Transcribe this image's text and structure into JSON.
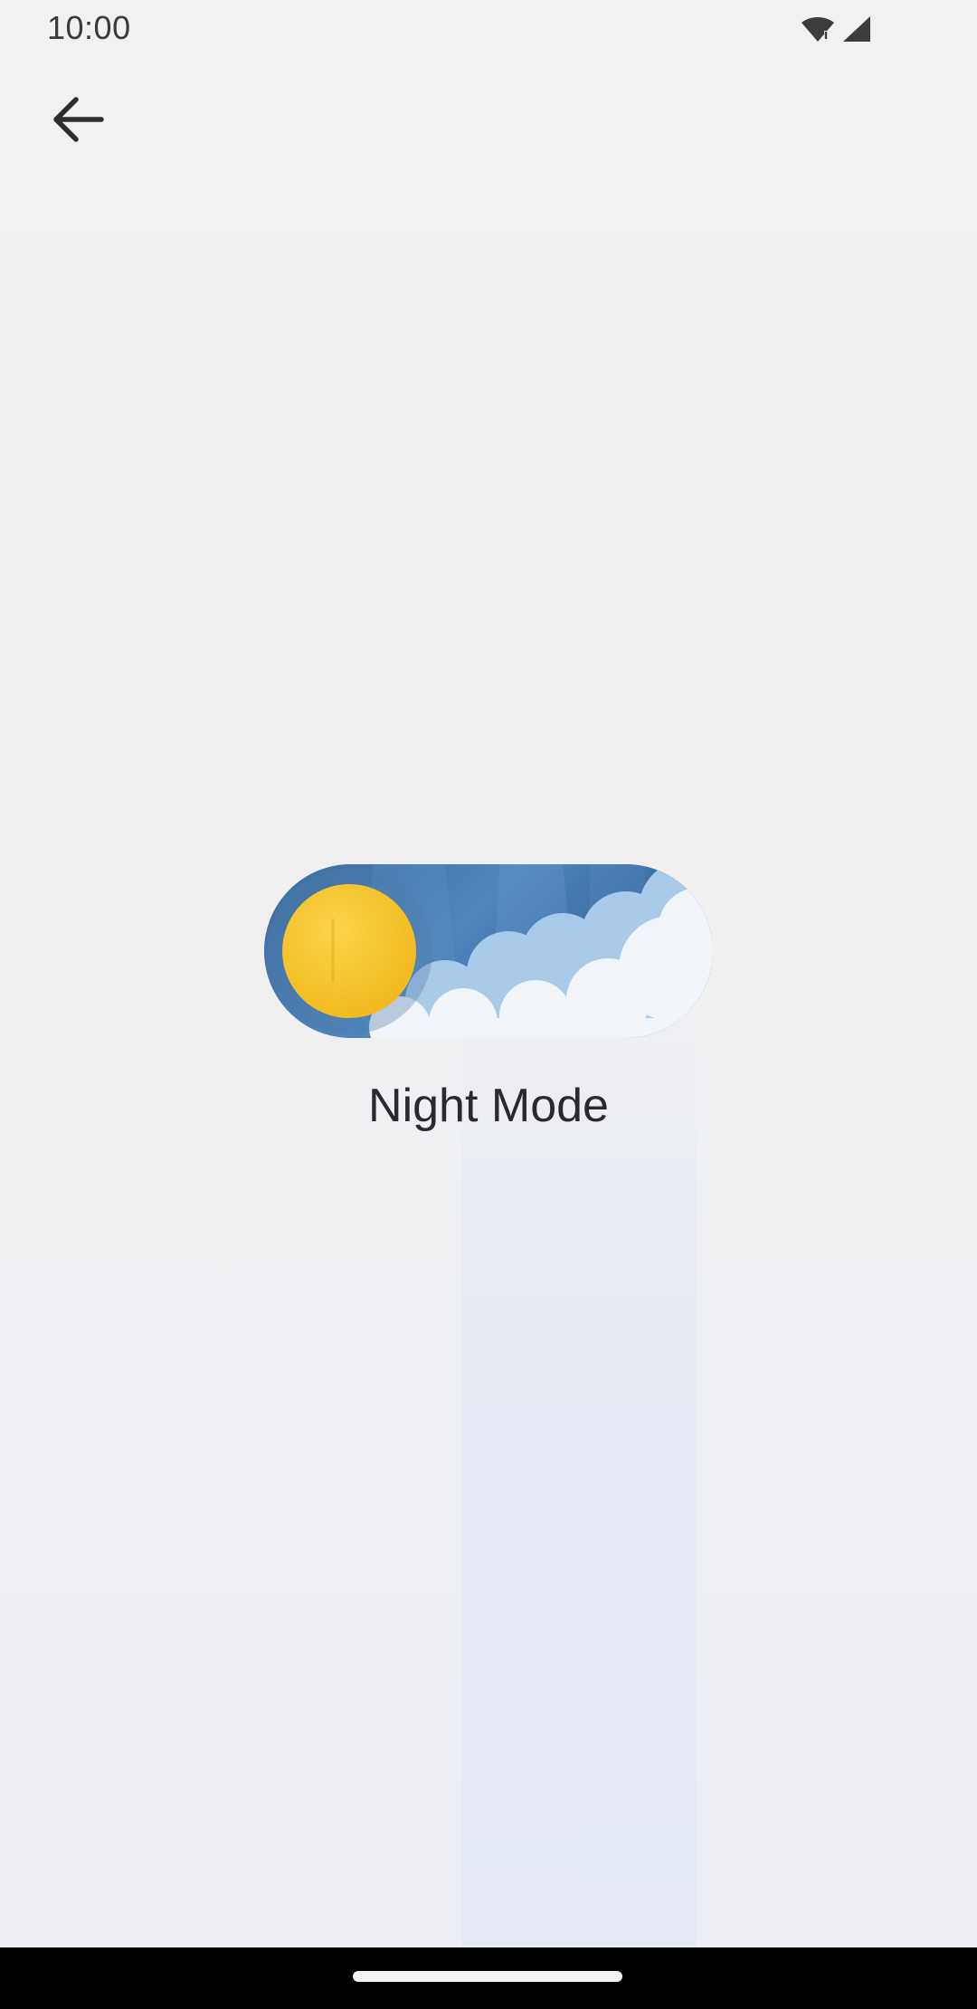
{
  "status_bar": {
    "time": "10:00",
    "icons": [
      "wifi-icon",
      "cell-signal-icon"
    ]
  },
  "toolbar": {
    "back_icon": "arrow-left-icon"
  },
  "toggle": {
    "state": "day",
    "on": false,
    "sun_color": "#f6c431",
    "sky_color": "#4a7db3",
    "cloud_color": "#f4f7fb"
  },
  "main": {
    "label": "Night Mode"
  },
  "nav_bar": {
    "home_indicator": "home-handle"
  }
}
